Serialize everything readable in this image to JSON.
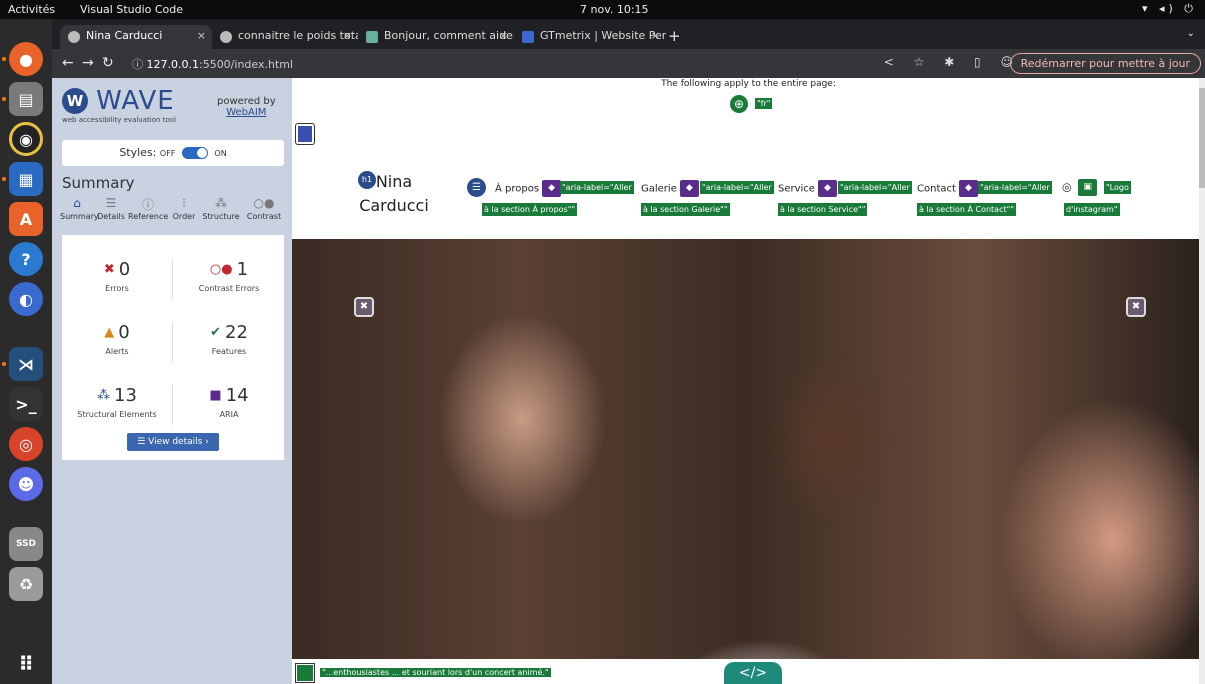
{
  "os": {
    "activities": "Activités",
    "app_name": "Visual Studio Code",
    "clock": "7 nov.  10:15",
    "tray": "▾ ◂) ⏻"
  },
  "browser": {
    "tabs": [
      {
        "label": "Nina Carducci",
        "active": true
      },
      {
        "label": "connaitre le poids total d",
        "active": false
      },
      {
        "label": "Bonjour, comment aider?",
        "active": false
      },
      {
        "label": "GTmetrix | Website Perfo",
        "active": false
      }
    ],
    "new_tab": "+",
    "url_host": "127.0.0.1",
    "url_path": ":5500/index.html",
    "relaunch": "Redémarrer pour mettre à jour"
  },
  "wave": {
    "logo_letter": "W",
    "name": "WAVE",
    "tagline": "web accessibility evaluation tool",
    "powered_by": "powered by",
    "powered_link": "WebAIM",
    "styles_label": "Styles:",
    "styles_off": "OFF",
    "styles_on": "ON",
    "summary_title": "Summary",
    "tabs": [
      "Summary",
      "Details",
      "Reference",
      "Order",
      "Structure",
      "Contrast"
    ],
    "stats": {
      "errors": {
        "value": "0",
        "label": "Errors",
        "color": "#c0262d"
      },
      "contrast": {
        "value": "1",
        "label": "Contrast Errors",
        "color": "#c0262d"
      },
      "alerts": {
        "value": "0",
        "label": "Alerts",
        "color": "#d9881a"
      },
      "features": {
        "value": "22",
        "label": "Features",
        "color": "#1e7a4a"
      },
      "structural": {
        "value": "13",
        "label": "Structural Elements",
        "color": "#2a4b8c"
      },
      "aria": {
        "value": "14",
        "label": "ARIA",
        "color": "#5a2d8c"
      }
    },
    "view_details": "View details ›"
  },
  "page": {
    "notice": "The following apply to the entire page:",
    "lang_tag": "\"fr\"",
    "h1_badge": "h1",
    "name": "Nina Carducci",
    "nav": [
      {
        "label": "À propos",
        "aria": "\"aria-label=\"Aller",
        "aria2": "à la section À propos\"\""
      },
      {
        "label": "Galerie",
        "aria": "\"aria-label=\"Aller",
        "aria2": "à la section Galerie\"\""
      },
      {
        "label": "Service",
        "aria": "\"aria-label=\"Aller",
        "aria2": "à la section Service\"\""
      },
      {
        "label": "Contact",
        "aria": "\"aria-label=\"Aller",
        "aria2": "à la section À Contact\"\""
      }
    ],
    "insta_aria": "\"Logo",
    "insta_aria2": "d'instagram\"",
    "alt_text": "\"...enthousiastes ... et souriant lors d'un concert animé.\"",
    "code_label": "</>"
  },
  "colors": {
    "wave_blue": "#2a4b8c",
    "feature_green": "#1a7a3a",
    "aria_purple": "#5a2d8c"
  }
}
